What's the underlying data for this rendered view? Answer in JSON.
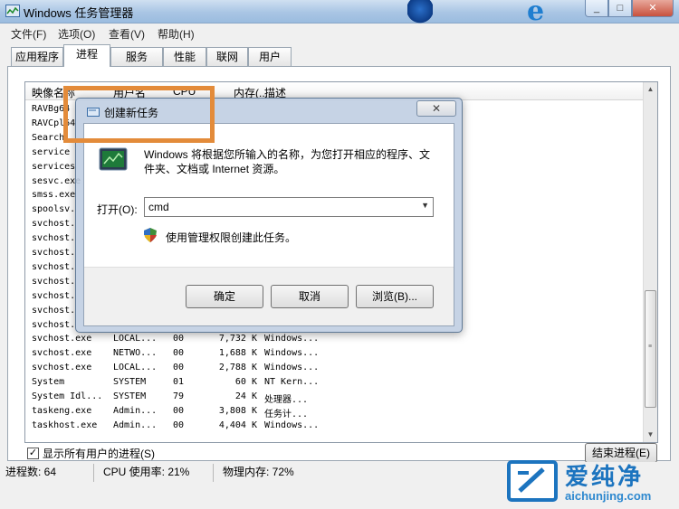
{
  "window": {
    "title": "Windows 任务管理器",
    "min": "▭",
    "max": "▢",
    "close": "✕"
  },
  "menu": [
    "文件(F)",
    "选项(O)",
    "查看(V)",
    "帮助(H)"
  ],
  "tabs": [
    {
      "label": "应用程序",
      "active": false
    },
    {
      "label": "进程",
      "active": true
    },
    {
      "label": "服务",
      "active": false
    },
    {
      "label": "性能",
      "active": false
    },
    {
      "label": "联网",
      "active": false
    },
    {
      "label": "用户",
      "active": false
    }
  ],
  "columns": {
    "image": "映像名称",
    "user": "用户名",
    "cpu": "CPU",
    "mem": "内存(...",
    "desc": "描述"
  },
  "processes": [
    {
      "image": "RAVBg64",
      "user": "",
      "cpu": "",
      "mem": "",
      "desc": ""
    },
    {
      "image": "RAVCpl64",
      "user": "",
      "cpu": "",
      "mem": "",
      "desc": ""
    },
    {
      "image": "Search",
      "user": "",
      "cpu": "",
      "mem": "",
      "desc": ""
    },
    {
      "image": "service",
      "user": "",
      "cpu": "",
      "mem": "",
      "desc": ""
    },
    {
      "image": "services",
      "user": "",
      "cpu": "",
      "mem": "",
      "desc": ""
    },
    {
      "image": "sesvc.exe",
      "user": "",
      "cpu": "",
      "mem": "",
      "desc": ""
    },
    {
      "image": "smss.exe",
      "user": "",
      "cpu": "",
      "mem": "",
      "desc": ""
    },
    {
      "image": "spoolsv.",
      "user": "",
      "cpu": "",
      "mem": "",
      "desc": ""
    },
    {
      "image": "svchost.",
      "user": "",
      "cpu": "",
      "mem": "",
      "desc": ""
    },
    {
      "image": "svchost.",
      "user": "",
      "cpu": "",
      "mem": "",
      "desc": ""
    },
    {
      "image": "svchost.",
      "user": "",
      "cpu": "",
      "mem": "",
      "desc": ""
    },
    {
      "image": "svchost.",
      "user": "",
      "cpu": "",
      "mem": "",
      "desc": ""
    },
    {
      "image": "svchost.",
      "user": "",
      "cpu": "",
      "mem": "",
      "desc": ""
    },
    {
      "image": "svchost.",
      "user": "",
      "cpu": "",
      "mem": "",
      "desc": ""
    },
    {
      "image": "svchost.",
      "user": "",
      "cpu": "",
      "mem": "",
      "desc": ""
    },
    {
      "image": "svchost.",
      "user": "",
      "cpu": "",
      "mem": "",
      "desc": ""
    },
    {
      "image": "svchost.exe",
      "user": "LOCAL...",
      "cpu": "00",
      "mem": "7,732 K",
      "desc": "Windows..."
    },
    {
      "image": "svchost.exe",
      "user": "NETWO...",
      "cpu": "00",
      "mem": "1,688 K",
      "desc": "Windows..."
    },
    {
      "image": "svchost.exe",
      "user": "LOCAL...",
      "cpu": "00",
      "mem": "2,788 K",
      "desc": "Windows..."
    },
    {
      "image": "System",
      "user": "SYSTEM",
      "cpu": "01",
      "mem": "60 K",
      "desc": "NT Kern..."
    },
    {
      "image": "System Idl...",
      "user": "SYSTEM",
      "cpu": "79",
      "mem": "24 K",
      "desc": "处理器..."
    },
    {
      "image": "taskeng.exe",
      "user": "Admin...",
      "cpu": "00",
      "mem": "3,808 K",
      "desc": "任务计..."
    },
    {
      "image": "taskhost.exe",
      "user": "Admin...",
      "cpu": "00",
      "mem": "4,404 K",
      "desc": "Windows..."
    }
  ],
  "show_all_users": {
    "label": "显示所有用户的进程(S)",
    "checked": true
  },
  "end_process_label": "结束进程(E)",
  "status": {
    "processes": "进程数: 64",
    "cpu": "CPU 使用率: 21%",
    "memory": "物理内存: 72%"
  },
  "dialog": {
    "title": "创建新任务",
    "close": "✕",
    "description": "Windows 将根据您所输入的名称，为您打开相应的程序、文件夹、文档或 Internet 资源。",
    "open_label": "打开(O):",
    "open_value": "cmd",
    "admin_text": "使用管理权限创建此任务。",
    "ok": "确定",
    "cancel": "取消",
    "browse": "浏览(B)..."
  },
  "watermark": {
    "name": "爱纯净",
    "url": "aichunjing.com"
  },
  "colors": {
    "highlight": "#e38b3a",
    "watermark": "#1c74bf"
  }
}
